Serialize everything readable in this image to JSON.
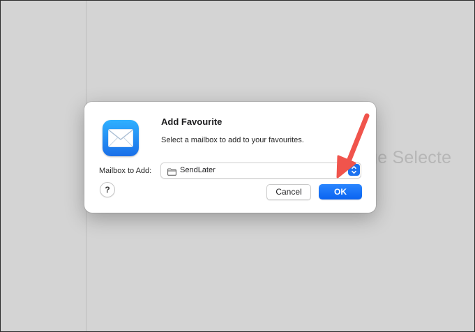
{
  "background": {
    "placeholder_text": "age Selecte"
  },
  "dialog": {
    "app_icon": "mail-envelope-icon",
    "title": "Add Favourite",
    "message": "Select a mailbox to add to your favourites.",
    "field_label": "Mailbox to Add:",
    "mailbox_select": {
      "value": "SendLater",
      "icon": "folder-icon"
    },
    "help_label": "?",
    "cancel_label": "Cancel",
    "ok_label": "OK"
  },
  "annotation": {
    "arrow_color": "#f0544c"
  },
  "colors": {
    "accent": "#0a63f0",
    "arrow": "#f0544c"
  }
}
